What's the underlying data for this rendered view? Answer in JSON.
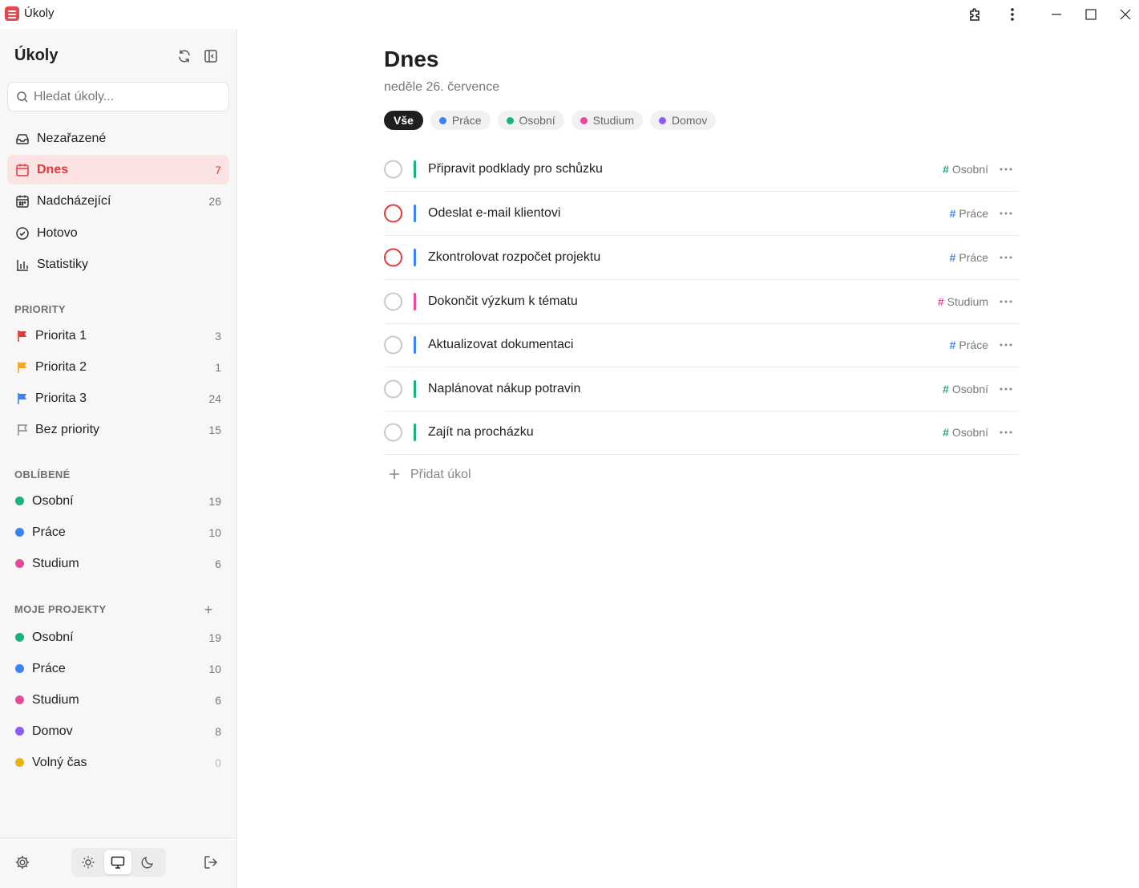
{
  "window": {
    "title": "Úkoly"
  },
  "sidebar": {
    "title": "Úkoly",
    "search_placeholder": "Hledat úkoly...",
    "nav": [
      {
        "label": "Nezařazené",
        "count": "",
        "icon": "inbox-icon"
      },
      {
        "label": "Dnes",
        "count": "7",
        "icon": "calendar-icon",
        "active": true
      },
      {
        "label": "Nadcházející",
        "count": "26",
        "icon": "calendar-grid-icon"
      },
      {
        "label": "Hotovo",
        "count": "",
        "icon": "check-circle-icon"
      },
      {
        "label": "Statistiky",
        "count": "",
        "icon": "bar-chart-icon"
      }
    ],
    "priorities_header": "PRIORITY",
    "priorities": [
      {
        "label": "Priorita 1",
        "count": "3",
        "color": "#e53939"
      },
      {
        "label": "Priorita 2",
        "count": "1",
        "color": "#f5a623"
      },
      {
        "label": "Priorita 3",
        "count": "24",
        "color": "#3b82f6"
      },
      {
        "label": "Bez priority",
        "count": "15",
        "color": "#888888"
      }
    ],
    "favorites_header": "OBLÍBENÉ",
    "favorites": [
      {
        "label": "Osobní",
        "count": "19",
        "color": "#16b37a"
      },
      {
        "label": "Práce",
        "count": "10",
        "color": "#3b82f6"
      },
      {
        "label": "Studium",
        "count": "6",
        "color": "#ec4899"
      }
    ],
    "projects_header": "MOJE PROJEKTY",
    "add_project_label": "+",
    "projects": [
      {
        "label": "Osobní",
        "count": "19",
        "color": "#16b37a"
      },
      {
        "label": "Práce",
        "count": "10",
        "color": "#3b82f6"
      },
      {
        "label": "Studium",
        "count": "6",
        "color": "#ec4899"
      },
      {
        "label": "Domov",
        "count": "8",
        "color": "#8b5cf6"
      },
      {
        "label": "Volný čas",
        "count": "0",
        "color": "#eab308"
      }
    ],
    "footer": {
      "theme_selected": "system"
    }
  },
  "main": {
    "title": "Dnes",
    "date": "neděle 26. července",
    "filters": [
      {
        "label": "Vše",
        "selected": true,
        "color": ""
      },
      {
        "label": "Práce",
        "color": "#3b82f6"
      },
      {
        "label": "Osobní",
        "color": "#16b37a"
      },
      {
        "label": "Studium",
        "color": "#ec4899"
      },
      {
        "label": "Domov",
        "color": "#8b5cf6"
      }
    ],
    "tasks": [
      {
        "title": "Připravit podklady pro schůzku",
        "tag": "Osobní",
        "tag_color": "#16b37a",
        "bar_color": "#16b37a",
        "priority_red": false
      },
      {
        "title": "Odeslat e-mail klientovi",
        "tag": "Práce",
        "tag_color": "#3b82f6",
        "bar_color": "#3b82f6",
        "priority_red": true
      },
      {
        "title": "Zkontrolovat rozpočet projektu",
        "tag": "Práce",
        "tag_color": "#3b82f6",
        "bar_color": "#3b82f6",
        "priority_red": true
      },
      {
        "title": "Dokončit výzkum k tématu",
        "tag": "Studium",
        "tag_color": "#ec4899",
        "bar_color": "#ec4899",
        "priority_red": false
      },
      {
        "title": "Aktualizovat dokumentaci",
        "tag": "Práce",
        "tag_color": "#3b82f6",
        "bar_color": "#3b82f6",
        "priority_red": false
      },
      {
        "title": "Naplánovat nákup potravin",
        "tag": "Osobní",
        "tag_color": "#16b37a",
        "bar_color": "#16b37a",
        "priority_red": false
      },
      {
        "title": "Zajít na procházku",
        "tag": "Osobní",
        "tag_color": "#16b37a",
        "bar_color": "#16b37a",
        "priority_red": false
      }
    ],
    "add_task_label": "Přidat úkol",
    "tag_hash": "#"
  }
}
